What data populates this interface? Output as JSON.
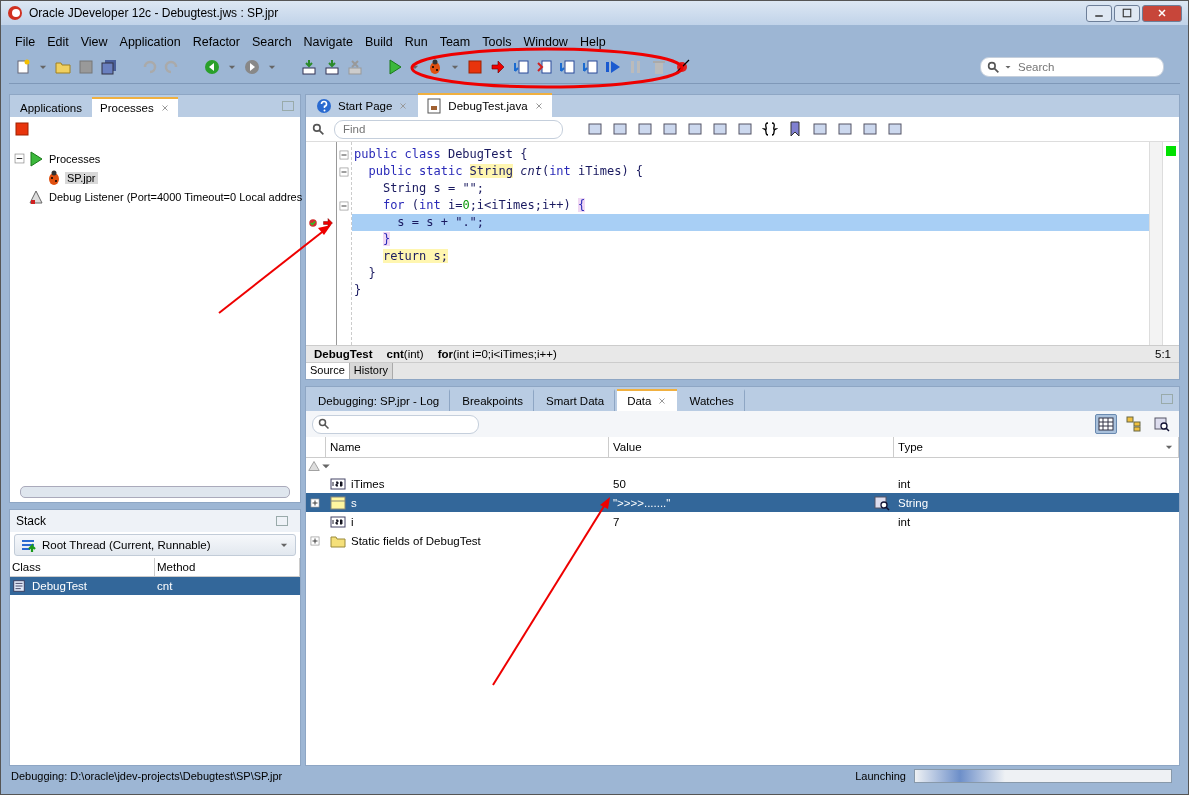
{
  "window": {
    "title": "Oracle JDeveloper 12c - Debugtest.jws : SP.jpr"
  },
  "menu": [
    "File",
    "Edit",
    "View",
    "Application",
    "Refactor",
    "Search",
    "Navigate",
    "Build",
    "Run",
    "Team",
    "Tools",
    "Window",
    "Help"
  ],
  "search": {
    "placeholder": "Search"
  },
  "left_tabs": [
    {
      "label": "Applications",
      "selected": false
    },
    {
      "label": "Processes",
      "selected": true
    }
  ],
  "process_tree": [
    {
      "label": "Processes",
      "kind": "run",
      "expanded": true,
      "children": [
        {
          "label": "SP.jpr",
          "kind": "bug",
          "selected": true
        }
      ]
    },
    {
      "label": "Debug Listener (Port=4000 Timeout=0 Local addres",
      "kind": "listener",
      "selected": false
    }
  ],
  "editor_tabs": [
    {
      "label": "Start Page",
      "kind": "help",
      "selected": false
    },
    {
      "label": "DebugTest.java",
      "kind": "java",
      "selected": true
    }
  ],
  "find": {
    "placeholder": "Find"
  },
  "code": [
    {
      "fold": true,
      "current": false,
      "tokens": [
        {
          "t": "public class ",
          "kind": "kw"
        },
        {
          "t": "DebugTest {",
          "kind": "id"
        }
      ]
    },
    {
      "fold": true,
      "current": false,
      "tokens": [
        {
          "t": "  public static ",
          "kind": "kw"
        },
        {
          "t": "String",
          "kind": "mark"
        },
        {
          "t": " cnt",
          "kind": "it"
        },
        {
          "t": "(",
          "kind": "id"
        },
        {
          "t": "int ",
          "kind": "kw"
        },
        {
          "t": "iTimes) {",
          "kind": "id"
        }
      ]
    },
    {
      "fold": false,
      "current": false,
      "tokens": [
        {
          "t": "    String s = \"\";",
          "kind": "id"
        }
      ]
    },
    {
      "fold": true,
      "current": false,
      "tokens": [
        {
          "t": "    for ",
          "kind": "kw"
        },
        {
          "t": "(",
          "kind": "id"
        },
        {
          "t": "int ",
          "kind": "kw"
        },
        {
          "t": "i=",
          "kind": "id"
        },
        {
          "t": "0",
          "kind": "num"
        },
        {
          "t": ";i<iTimes;i++) ",
          "kind": "id"
        },
        {
          "t": "{",
          "kind": "brace"
        }
      ]
    },
    {
      "fold": false,
      "current": true,
      "tokens": [
        {
          "t": "      s = s + \".\";",
          "kind": "id"
        }
      ]
    },
    {
      "fold": false,
      "current": false,
      "tokens": [
        {
          "t": "    }",
          "kind": "brace"
        }
      ]
    },
    {
      "fold": false,
      "current": false,
      "tokens": [
        {
          "t": "    return s;",
          "kind": "mark"
        }
      ]
    },
    {
      "fold": false,
      "current": false,
      "tokens": [
        {
          "t": "  }",
          "kind": "id"
        }
      ]
    },
    {
      "fold": false,
      "current": false,
      "tokens": [
        {
          "t": "}",
          "kind": "id"
        }
      ]
    }
  ],
  "breadcrumbs": [
    {
      "bold": "DebugTest"
    },
    {
      "bold": "cnt",
      "rest": "(int)"
    },
    {
      "bold": "for",
      "rest": "(int i=0;i<iTimes;i++)"
    }
  ],
  "cursor_position": "5:1",
  "editor_bottom_tabs": [
    {
      "label": "Source",
      "selected": true
    },
    {
      "label": "History",
      "selected": false
    }
  ],
  "stack": {
    "title": "Stack",
    "thread": "Root Thread (Current, Runnable)",
    "columns": [
      "Class",
      "Method"
    ],
    "rows": [
      {
        "class": "DebugTest",
        "method": "cnt",
        "selected": true
      }
    ]
  },
  "debug_tabs": [
    {
      "label": "Debugging: SP.jpr - Log",
      "selected": false
    },
    {
      "label": "Breakpoints",
      "selected": false
    },
    {
      "label": "Smart Data",
      "selected": false
    },
    {
      "label": "Data",
      "selected": true
    },
    {
      "label": "Watches",
      "selected": false
    }
  ],
  "data_table": {
    "columns": [
      "Name",
      "Value",
      "Type"
    ],
    "rows": [
      {
        "name": "iTimes",
        "value": "50",
        "type": "int",
        "kind": "primitive",
        "expandable": false,
        "selected": false
      },
      {
        "name": "s",
        "value": "\">>>>.......\"",
        "type": "String",
        "kind": "object",
        "expandable": true,
        "selected": true
      },
      {
        "name": "i",
        "value": "7",
        "type": "int",
        "kind": "primitive",
        "expandable": false,
        "selected": false
      },
      {
        "name": "Static fields of DebugTest",
        "kind": "folder",
        "expandable": true,
        "selected": false
      }
    ]
  },
  "status_bar": {
    "text": "Debugging: D:\\oracle\\jdev-projects\\Debugtest\\SP\\SP.jpr",
    "progress_label": "Launching",
    "level": 0.35
  }
}
